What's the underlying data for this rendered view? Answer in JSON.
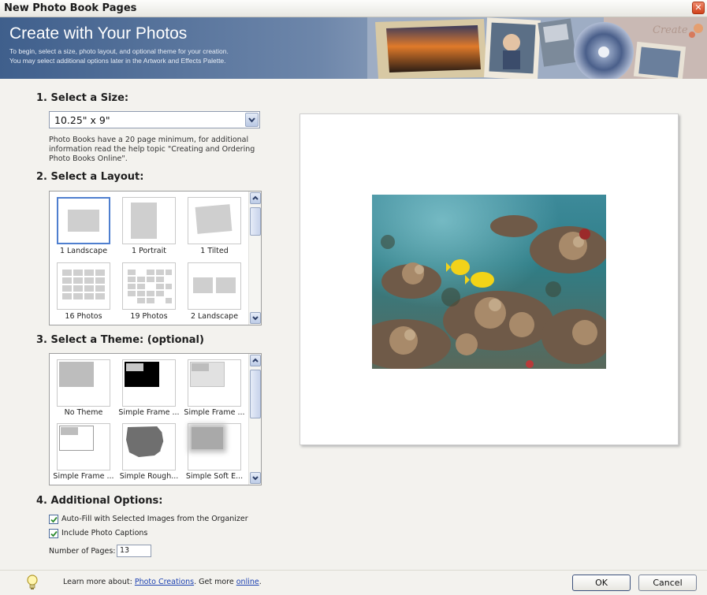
{
  "window": {
    "title": "New Photo Book Pages",
    "close_icon": "close-icon"
  },
  "header": {
    "title": "Create with Your Photos",
    "description_line1": "To begin, select a size, photo layout, and optional theme for your creation.",
    "description_line2": "You may select additional options later in the Artwork and Effects Palette."
  },
  "size": {
    "heading": "1. Select a Size:",
    "selected": "10.25\" x 9\"",
    "note_line1": "Photo Books have a 20 page minimum, for additional",
    "note_line2": "information read the help topic \"Creating and Ordering",
    "note_line3": "Photo Books Online\"."
  },
  "layout": {
    "heading": "2. Select a Layout:",
    "items": [
      {
        "label": "1 Landscape",
        "selected": true
      },
      {
        "label": "1 Portrait",
        "selected": false
      },
      {
        "label": "1 Tilted",
        "selected": false
      },
      {
        "label": "16 Photos",
        "selected": false
      },
      {
        "label": "19 Photos",
        "selected": false
      },
      {
        "label": "2 Landscape",
        "selected": false
      }
    ]
  },
  "theme": {
    "heading": "3. Select a Theme: (optional)",
    "items": [
      {
        "label": "No Theme"
      },
      {
        "label": "Simple Frame ..."
      },
      {
        "label": "Simple Frame ..."
      },
      {
        "label": "Simple Frame ..."
      },
      {
        "label": "Simple Rough..."
      },
      {
        "label": "Simple Soft E..."
      }
    ]
  },
  "options": {
    "heading": "4. Additional Options:",
    "autofill_label": "Auto-Fill with Selected Images from the Organizer",
    "autofill_checked": true,
    "captions_label": "Include Photo Captions",
    "captions_checked": true,
    "pages_label": "Number of Pages:",
    "pages_value": "13"
  },
  "footer": {
    "learn_prefix": "Learn more about: ",
    "learn_link": "Photo Creations",
    "more_text": ". Get more ",
    "more_link": "online",
    "end_text": ".",
    "ok_label": "OK",
    "cancel_label": "Cancel"
  },
  "colors": {
    "accent": "#4f7fcf",
    "header_blue": "#3f5f8c",
    "link": "#1a3fb0"
  }
}
